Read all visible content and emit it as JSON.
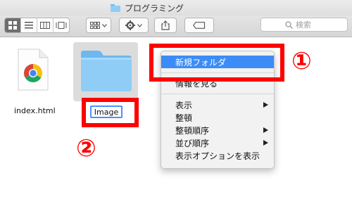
{
  "window": {
    "title": "プログラミング"
  },
  "toolbar": {
    "search_placeholder": "検索"
  },
  "files": [
    {
      "name": "index.html",
      "type": "chrome-html-file-icon"
    },
    {
      "name": "Image",
      "type": "folder-icon",
      "state": "renaming"
    }
  ],
  "context_menu": {
    "items": [
      {
        "label": "新規フォルダ",
        "highlighted": true
      },
      {
        "label": "情報を見る"
      },
      {
        "label": "表示",
        "submenu": true
      },
      {
        "label": "整頓"
      },
      {
        "label": "整頓順序",
        "submenu": true
      },
      {
        "label": "並び順序",
        "submenu": true
      },
      {
        "label": "表示オプションを表示"
      }
    ]
  },
  "annotations": {
    "first": "①",
    "second": "②",
    "color": "#ff0000"
  },
  "colors": {
    "menu_highlight": "#3b8cf7",
    "folder": "#8fcdf7"
  }
}
